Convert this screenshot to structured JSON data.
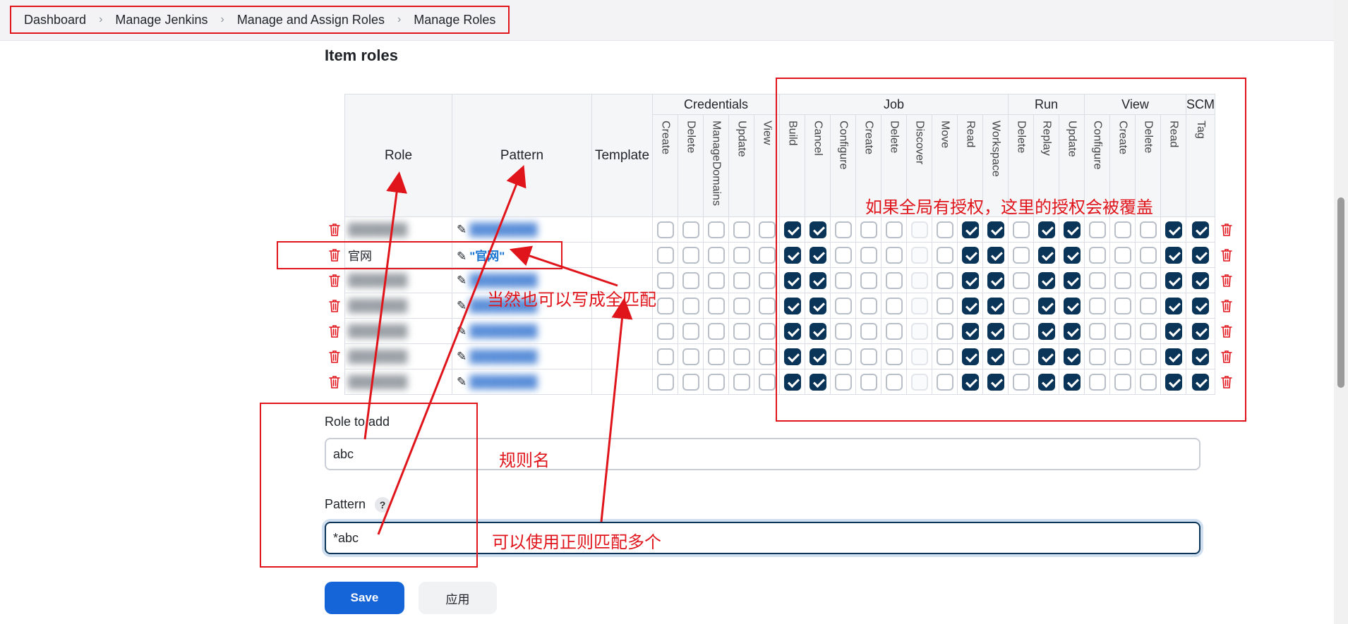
{
  "breadcrumb": [
    "Dashboard",
    "Manage Jenkins",
    "Manage and Assign Roles",
    "Manage Roles"
  ],
  "section_title": "Item roles",
  "table": {
    "col_role": "Role",
    "col_pattern": "Pattern",
    "col_template": "Template",
    "groups": [
      {
        "name": "Credentials",
        "perms": [
          "Create",
          "Delete",
          "ManageDomains",
          "Update",
          "View"
        ]
      },
      {
        "name": "Job",
        "perms": [
          "Build",
          "Cancel",
          "Configure",
          "Create",
          "Delete",
          "Discover",
          "Move",
          "Read",
          "Workspace"
        ]
      },
      {
        "name": "Run",
        "perms": [
          "Delete",
          "Replay",
          "Update"
        ]
      },
      {
        "name": "View",
        "perms": [
          "Configure",
          "Create",
          "Delete",
          "Read"
        ]
      },
      {
        "name": "SCM",
        "perms": [
          "Tag"
        ]
      }
    ],
    "rows": [
      {
        "role": "",
        "pattern": "",
        "obscured": true
      },
      {
        "role": "官网",
        "pattern": "\"官网\"",
        "obscured": false
      },
      {
        "role": "",
        "pattern": "",
        "obscured": true
      },
      {
        "role": "",
        "pattern": "",
        "obscured": true
      },
      {
        "role": "",
        "pattern": "",
        "obscured": true
      },
      {
        "role": "",
        "pattern": "",
        "obscured": true
      },
      {
        "role": "",
        "pattern": "",
        "obscured": true
      }
    ],
    "permission_state": [
      0,
      0,
      0,
      0,
      0,
      1,
      1,
      0,
      0,
      0,
      "d",
      0,
      1,
      1,
      0,
      1,
      1,
      0,
      0,
      0,
      1,
      1
    ]
  },
  "form": {
    "role_label": "Role to add",
    "role_value": "abc",
    "pattern_label": "Pattern",
    "help": "?",
    "pattern_value": "*abc",
    "save": "Save",
    "apply": "应用"
  },
  "annotations": {
    "override_note": "如果全局有授权，这里的授权会被覆盖",
    "full_match_note": "当然也可以写成全匹配",
    "rule_name_note": "规则名",
    "regex_note": "可以使用正则匹配多个"
  },
  "colors": {
    "annotation": "#e0141b",
    "checked": "#0b3558",
    "primary_button": "#1565d8",
    "link": "#1976d2"
  }
}
